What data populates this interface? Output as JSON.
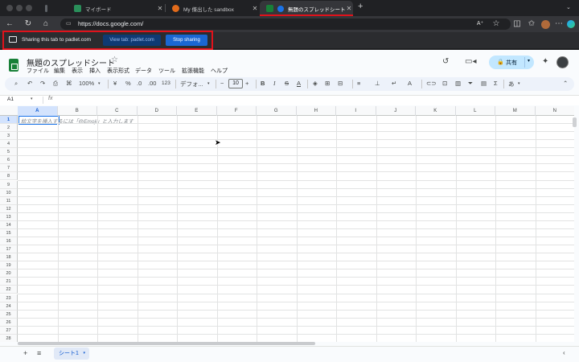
{
  "browser": {
    "tabs": [
      {
        "label": "マイボード",
        "icon_color": "#2a8f5a"
      },
      {
        "label": "My 傑出した sandbox",
        "icon_color": "#e26b1b"
      },
      {
        "label": "無題のスプレッドシート - Go",
        "icon_color": "#1a73e8"
      }
    ],
    "url": "https://docs.google.com/",
    "new_tab": "+",
    "zoom_badge": "A⁺"
  },
  "sharing_bar": {
    "message": "Sharing this tab to padlet.com",
    "view_tab_label": "View tab: padlet.com",
    "stop_label": "Stop sharing"
  },
  "sheets": {
    "title": "無題のスプレッドシート",
    "menu": [
      "ファイル",
      "編集",
      "表示",
      "挿入",
      "表示形式",
      "データ",
      "ツール",
      "拡張機能",
      "ヘルプ"
    ],
    "share_label": "共有",
    "toolbar": {
      "zoom": "100%",
      "currency": "¥",
      "percent": "%",
      "dec_decrease": ".0",
      "dec_increase": ".00",
      "number_format": "123",
      "font": "デフォ...",
      "font_size": "10"
    },
    "name_box": "A1",
    "fx": "fx",
    "columns": [
      "A",
      "B",
      "C",
      "D",
      "E",
      "F",
      "G",
      "H",
      "I",
      "J",
      "K",
      "L",
      "M",
      "N"
    ],
    "rows": [
      "1",
      "2",
      "3",
      "4",
      "5",
      "6",
      "7",
      "8",
      "9",
      "10",
      "11",
      "12",
      "13",
      "14",
      "15",
      "16",
      "17",
      "18",
      "19",
      "20",
      "21",
      "22",
      "23",
      "24",
      "25",
      "26",
      "27",
      "28"
    ],
    "cell_hint": "絵文字を挿入するには「@Emoji」と入力します",
    "sheet_tab": "シート1"
  },
  "colors": {
    "accent": "#1a73e8",
    "share_btn": "#c2e7ff",
    "highlight_red": "#e0121b",
    "sheets_green": "#188038"
  }
}
